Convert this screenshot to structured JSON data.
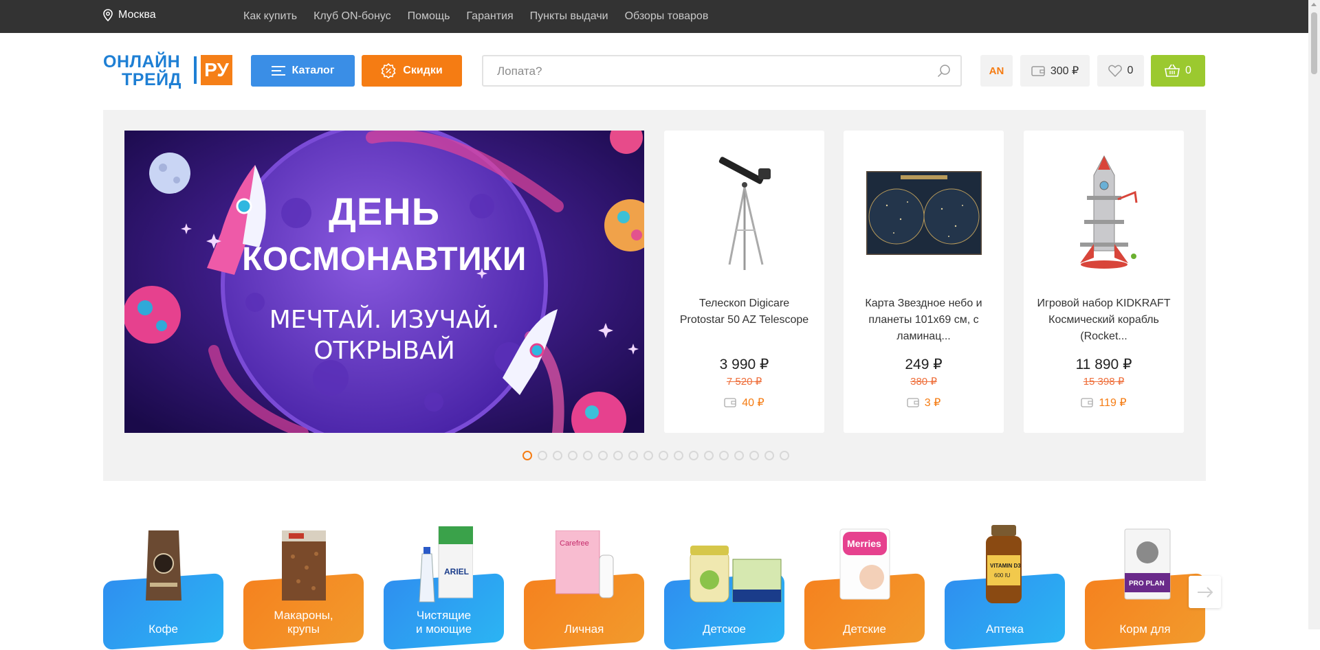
{
  "topbar": {
    "city": "Москва",
    "nav": [
      "Как купить",
      "Клуб ON-бонус",
      "Помощь",
      "Гарантия",
      "Пункты выдачи",
      "Обзоры товаров"
    ]
  },
  "header": {
    "logo_line1": "ОНЛАЙН",
    "logo_line2": "ТРЕЙД",
    "logo_ru": "РУ",
    "catalog_label": "Каталог",
    "sale_label": "Скидки",
    "search_placeholder": "Лопата?",
    "user_initials": "AN",
    "bonus_balance": "300 ₽",
    "favorites_count": "0",
    "cart_count": "0"
  },
  "banner": {
    "title_line1": "ДЕНЬ",
    "title_line2": "КОСМОНАВТИКИ",
    "sub_line1": "МЕЧТАЙ. ИЗУЧАЙ.",
    "sub_line2": "ОТКРЫВАЙ"
  },
  "products": [
    {
      "name": "Телескоп Digicare Protostar 50 AZ Telescope",
      "price": "3 990 ₽",
      "old_price": "7 520 ₽",
      "bonus": "40 ₽",
      "icon": "telescope-image"
    },
    {
      "name": "Карта Звездное небо и планеты 101х69 см, с ламинац...",
      "price": "249 ₽",
      "old_price": "380 ₽",
      "bonus": "3 ₽",
      "icon": "star-map-image"
    },
    {
      "name": "Игровой набор KIDKRAFT Космический корабль (Rocket...",
      "price": "11 890 ₽",
      "old_price": "15 398 ₽",
      "bonus": "119 ₽",
      "icon": "rocket-toy-image"
    }
  ],
  "slider": {
    "total": 18,
    "active": 1
  },
  "categories": [
    {
      "label_line1": "Кофе",
      "label_line2": "",
      "color": "blue"
    },
    {
      "label_line1": "Макароны,",
      "label_line2": "крупы",
      "color": "orange"
    },
    {
      "label_line1": "Чистящие",
      "label_line2": "и моющие",
      "color": "blue"
    },
    {
      "label_line1": "Личная",
      "label_line2": "",
      "color": "orange"
    },
    {
      "label_line1": "Детское",
      "label_line2": "",
      "color": "blue"
    },
    {
      "label_line1": "Детские",
      "label_line2": "",
      "color": "orange"
    },
    {
      "label_line1": "Аптека",
      "label_line2": "",
      "color": "blue"
    },
    {
      "label_line1": "Корм для",
      "label_line2": "",
      "color": "orange"
    }
  ],
  "colors": {
    "accent_orange": "#f57c13",
    "accent_blue": "#3a8ee6",
    "cart_green": "#9bc92f"
  }
}
